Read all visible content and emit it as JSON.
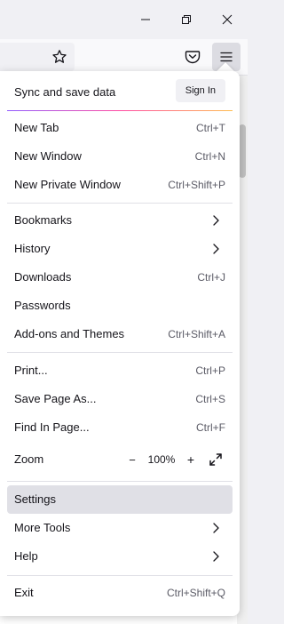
{
  "titlebar": {
    "minimize_icon": "minimize-icon",
    "restore_icon": "restore-icon",
    "close_icon": "close-icon"
  },
  "toolbar": {
    "bookmark_icon": "star-icon",
    "pocket_icon": "pocket-icon",
    "menu_icon": "hamburger-menu-icon"
  },
  "menu": {
    "sync": {
      "title": "Sync and save data",
      "button": "Sign In"
    },
    "new_tab": {
      "label": "New Tab",
      "shortcut": "Ctrl+T"
    },
    "new_window": {
      "label": "New Window",
      "shortcut": "Ctrl+N"
    },
    "new_private_window": {
      "label": "New Private Window",
      "shortcut": "Ctrl+Shift+P"
    },
    "bookmarks": {
      "label": "Bookmarks"
    },
    "history": {
      "label": "History"
    },
    "downloads": {
      "label": "Downloads",
      "shortcut": "Ctrl+J"
    },
    "passwords": {
      "label": "Passwords"
    },
    "addons": {
      "label": "Add-ons and Themes",
      "shortcut": "Ctrl+Shift+A"
    },
    "print": {
      "label": "Print...",
      "shortcut": "Ctrl+P"
    },
    "save_page": {
      "label": "Save Page As...",
      "shortcut": "Ctrl+S"
    },
    "find": {
      "label": "Find In Page...",
      "shortcut": "Ctrl+F"
    },
    "zoom": {
      "label": "Zoom",
      "minus": "−",
      "value": "100%",
      "plus": "+"
    },
    "settings": {
      "label": "Settings"
    },
    "more_tools": {
      "label": "More Tools"
    },
    "help": {
      "label": "Help"
    },
    "exit": {
      "label": "Exit",
      "shortcut": "Ctrl+Shift+Q"
    }
  },
  "colors": {
    "accent_gradient": [
      "#9059ff",
      "#ff4aa2",
      "#ffbd4f"
    ],
    "hover": "#e0e0e6"
  }
}
